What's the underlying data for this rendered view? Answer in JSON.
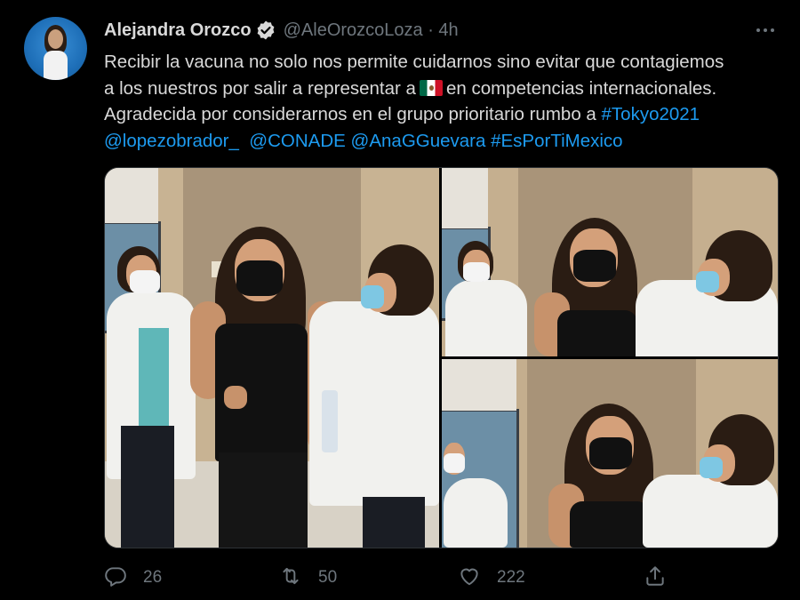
{
  "author": {
    "name": "Alejandra Orozco",
    "handle_time": "@AleOrozcoLoza · 4h"
  },
  "tweet": {
    "line1": "Recibir la vacuna no solo nos permite cuidarnos sino evitar que contagiemos",
    "line2_before": "a los nuestros por salir a representar a",
    "line2_after": "en competencias internacionales.",
    "line3_text": "Agradecida por considerarnos en el grupo prioritario rumbo a",
    "hashtag_tokyo": "#Tokyo2021",
    "mention_lopez": "@lopezobrador_",
    "mention_conade": "@CONADE",
    "mention_ana": "@AnaGGuevara",
    "hashtag_espor": "#EsPorTiMexico"
  },
  "actions": {
    "reply_count": "26",
    "retweet_count": "50",
    "like_count": "222"
  },
  "icons": {
    "verified": "verified-badge-icon",
    "more": "more-options-icon",
    "reply": "reply-icon",
    "retweet": "retweet-icon",
    "like": "heart-icon",
    "share": "share-icon",
    "flag": "mexico-flag-emoji"
  },
  "colors": {
    "background": "#000000",
    "text": "#d9d9d9",
    "secondary": "#6e767d",
    "link": "#1d9bf0"
  }
}
